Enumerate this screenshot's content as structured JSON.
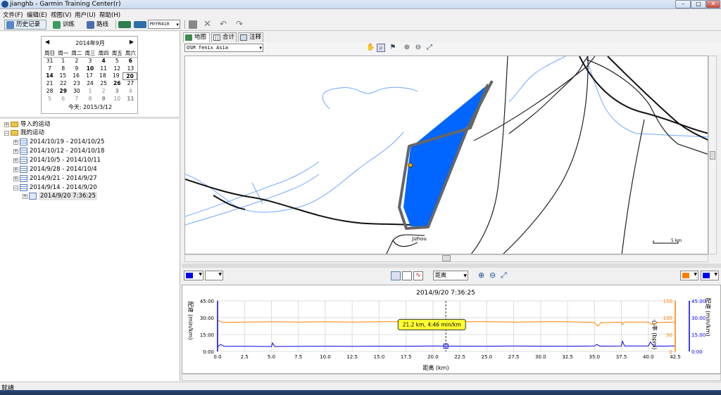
{
  "window": {
    "title": "jianghb - Garmin Training Center(r)"
  },
  "menu": [
    "文件(F)",
    "编辑(E)",
    "视图(V)",
    "用户(U)",
    "帮助(H)"
  ],
  "toolbar": {
    "history": "历史记录",
    "training": "训练",
    "courses": "路线",
    "device": "MYFR410"
  },
  "calendar": {
    "month": "2014年9月",
    "weekdays": [
      "周日",
      "周一",
      "周二",
      "周三",
      "周四",
      "周五",
      "周六"
    ],
    "rows": [
      [
        "31",
        "1",
        "2",
        "3",
        "4",
        "5",
        "6"
      ],
      [
        "7",
        "8",
        "9",
        "10",
        "11",
        "12",
        "13"
      ],
      [
        "14",
        "15",
        "16",
        "17",
        "18",
        "19",
        "20"
      ],
      [
        "21",
        "22",
        "23",
        "24",
        "25",
        "26",
        "27"
      ],
      [
        "28",
        "29",
        "30",
        "1",
        "2",
        "3",
        "4"
      ],
      [
        "5",
        "6",
        "7",
        "8",
        "9",
        "10",
        "11"
      ]
    ],
    "today": "今天: 2015/3/12"
  },
  "tree": {
    "imported": "导入的运动",
    "mine": "我的运动",
    "weeks": [
      "2014/10/19 - 2014/10/25",
      "2014/10/12 - 2014/10/18",
      "2014/10/5 - 2014/10/11",
      "2014/9/28 - 2014/10/4",
      "2014/9/21 - 2014/9/27",
      "2014/9/14 - 2014/9/20"
    ],
    "activity": "2014/9/20 7:36:25"
  },
  "tabs": {
    "map": "地图",
    "totals": "合计",
    "notes": "注释"
  },
  "map": {
    "source": "OSM fenix Asia",
    "place_label": "Jizhou",
    "scale_label": "5 km",
    "track_color": "#666666",
    "lake_color": "#0066ff"
  },
  "chartbar": {
    "xaxis_select": "距离",
    "left_color": "#0000ee",
    "right_color": "#ff8000"
  },
  "chart_data": {
    "type": "line",
    "title": "2014/9/20 7:36:25",
    "xlabel": "距离 (km)",
    "ylabel_left": "配速 (min/km)",
    "ylabel_right1": "心率 (bpm)",
    "ylabel_right2": "配速 (min/km)",
    "xlim": [
      0,
      42.5
    ],
    "ylim_pace": [
      0,
      45
    ],
    "ylim_hr": [
      0,
      150
    ],
    "xticks": [
      "0.0",
      "2.5",
      "5.0",
      "7.5",
      "10.0",
      "12.5",
      "15.0",
      "17.5",
      "20.0",
      "22.5",
      "25.0",
      "27.5",
      "30.0",
      "32.5",
      "35.0",
      "37.5",
      "40.0",
      "42.5"
    ],
    "pace_ticks": [
      "45:00",
      "30:00",
      "15:00",
      "0:00"
    ],
    "hr_ticks": [
      "150",
      "100",
      "50",
      "0"
    ],
    "series": [
      {
        "color": "#ff8000",
        "x": [
          0,
          0.5,
          2.5,
          5,
          7.5,
          10,
          12.5,
          15,
          17.5,
          20,
          22.5,
          25,
          27.5,
          30,
          32.5,
          35,
          35.3,
          35.6,
          37.5,
          37.6,
          37.8,
          40,
          40.3,
          41,
          42.5
        ],
        "y": [
          92,
          86,
          87,
          88,
          87,
          88,
          87,
          88,
          88,
          87,
          88,
          88,
          87,
          88,
          88,
          86,
          75,
          85,
          87,
          80,
          87,
          87,
          80,
          86,
          87
        ]
      },
      {
        "color": "#0000ee",
        "x": [
          0,
          0.3,
          0.6,
          2.5,
          5,
          5.1,
          5.3,
          7.5,
          10,
          12.5,
          15,
          17.5,
          20,
          22.5,
          25,
          27.5,
          30,
          32.5,
          35,
          35.2,
          35.5,
          37.5,
          37.6,
          37.8,
          40,
          40.2,
          40.5,
          42.5
        ],
        "y": [
          4.2,
          6.2,
          4.5,
          4.6,
          4.4,
          7.5,
          4.4,
          4.5,
          4.6,
          4.5,
          4.7,
          4.6,
          4.8,
          4.7,
          4.6,
          4.8,
          4.7,
          4.6,
          4.8,
          6.2,
          4.7,
          4.9,
          9,
          4.8,
          4.9,
          8.5,
          4.7,
          4.8
        ]
      }
    ],
    "annotation": {
      "x": 21.2,
      "y": 4.77,
      "text": "21.2 km, 4:46 min/km"
    }
  },
  "status": "就绪"
}
